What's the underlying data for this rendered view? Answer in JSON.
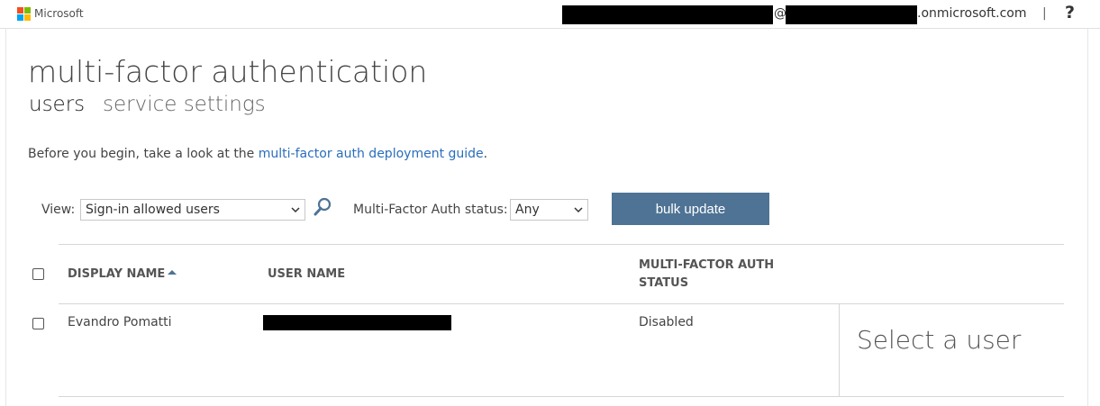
{
  "header": {
    "brand": "Microsoft",
    "account": {
      "at_sign": "@",
      "domain_suffix": ".onmicrosoft.com"
    },
    "separator": "|",
    "help_label": "?",
    "logo_colors": [
      "#f25022",
      "#7fba00",
      "#00a4ef",
      "#ffb900"
    ]
  },
  "page": {
    "title": "multi-factor authentication",
    "tabs": [
      {
        "label": "users",
        "active": true
      },
      {
        "label": "service settings",
        "active": false
      }
    ],
    "intro_text": "Before you begin, take a look at the ",
    "intro_link": "multi-factor auth deployment guide",
    "intro_end": "."
  },
  "filters": {
    "view_label": "View:",
    "view_value": "Sign-in allowed users",
    "status_label": "Multi-Factor Auth status:",
    "status_value": "Any",
    "bulk_update_label": "bulk update",
    "search_icon": "search-icon"
  },
  "table": {
    "columns": [
      "DISPLAY NAME",
      "USER NAME",
      "MULTI-FACTOR AUTH",
      "STATUS"
    ],
    "sort": {
      "column": "DISPLAY NAME",
      "direction": "ascending"
    },
    "rows": [
      {
        "display_name": "Evandro Pomatti",
        "user_name_redacted": true,
        "mfa_status": "Disabled"
      }
    ]
  },
  "detail_panel": {
    "placeholder": "Select a user"
  },
  "colors": {
    "accent_button": "#4e7394",
    "link": "#2a6ebb",
    "redaction": "#000000"
  }
}
